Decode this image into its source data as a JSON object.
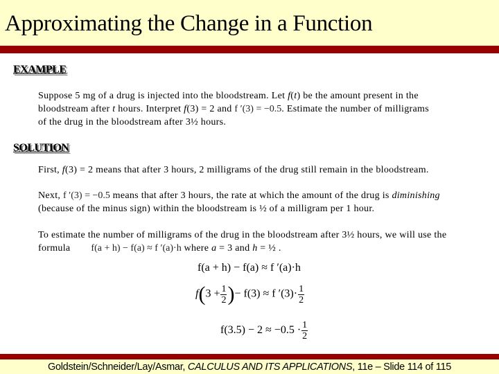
{
  "slide": {
    "title": "Approximating the Change in a Function",
    "colors": {
      "title_bg": "#ffffcc",
      "bar": "#990000",
      "text": "#000000"
    }
  },
  "example": {
    "heading": "EXAMPLE",
    "line1_a": "Suppose 5 mg of a drug is injected into the bloodstream.  Let ",
    "line1_f": "f",
    "line1_b": "(",
    "line1_t": "t",
    "line1_c": ") be the amount present in the",
    "line2_a": "bloodstream after ",
    "line2_t": "t",
    "line2_b": " hours.  Interpret ",
    "line2_f": "f",
    "line2_c": "(3) = 2 and ",
    "line2_math": "f ′(3) = −0.5",
    "line2_d": ". Estimate the number of milligrams",
    "line3": "of the drug in the bloodstream after 3½ hours."
  },
  "solution": {
    "heading": "SOLUTION",
    "first_a": "First, ",
    "first_f": "f",
    "first_b": "(3) = 2 means that after 3 hours, 2 milligrams of the drug still remain in the bloodstream.",
    "next_a": "Next, ",
    "next_math": "f ′(3) = −0.5",
    "next_b": "  means that after 3 hours, the rate at which the amount of the drug is ",
    "next_em": "diminishing",
    "next_line2": "(because of the minus sign) within the bloodstream is ½ of a milligram per 1 hour.",
    "estimate_line1": "To estimate the number of milligrams of the drug in the bloodstream after 3½ hours, we will use the",
    "estimate_a": "formula",
    "estimate_formula": "f(a + h) − f(a) ≈ f ′(a)·h",
    "estimate_b": "where ",
    "estimate_a_var": "a",
    "estimate_c": " = 3 and ",
    "estimate_h_var": "h",
    "estimate_d": " = ½ ."
  },
  "equations": {
    "eq1": "f(a + h) − f(a) ≈ f ′(a)·h",
    "eq2_left_f": "f",
    "eq2_three": "3 +",
    "eq2_num": "1",
    "eq2_den": "2",
    "eq2_mid": "− f(3) ≈ f ′(3)·",
    "eq3_left": "f(3.5) − 2 ≈ −0.5 ·",
    "eq3_num": "1",
    "eq3_den": "2"
  },
  "footer": {
    "authors": "Goldstein/Schneider/Lay/Asmar, ",
    "book": "CALCULUS AND ITS APPLICATIONS",
    "edition": ", 11e – Slide 114 of 115"
  }
}
